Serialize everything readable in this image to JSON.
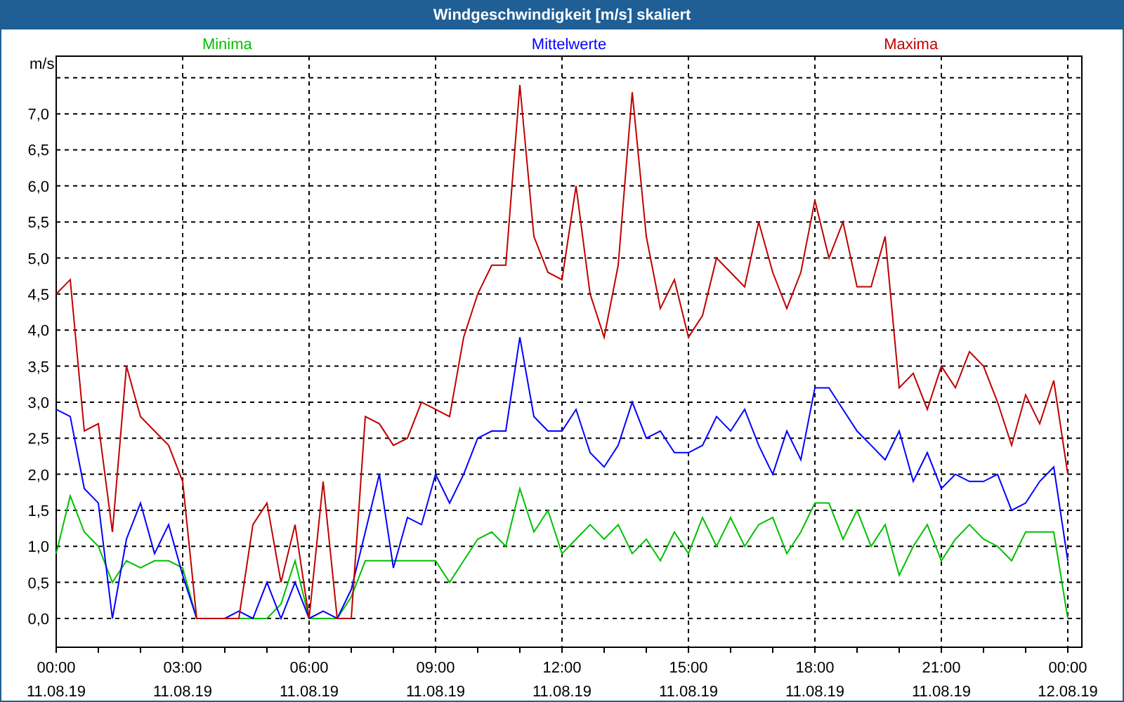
{
  "window": {
    "title": "Windgeschwindigkeit [m/s] skaliert"
  },
  "chart": {
    "chart_data": {
      "type": "line",
      "grid": true,
      "ylabel": "m/s",
      "categories": [
        "00:00",
        null,
        null,
        null,
        null,
        null,
        null,
        null,
        null,
        "03:00",
        null,
        null,
        null,
        null,
        null,
        null,
        null,
        null,
        "06:00",
        null,
        null,
        null,
        null,
        null,
        null,
        null,
        null,
        "09:00",
        null,
        null,
        null,
        null,
        null,
        null,
        null,
        null,
        "12:00",
        null,
        null,
        null,
        null,
        null,
        null,
        null,
        null,
        "15:00",
        null,
        null,
        null,
        null,
        null,
        null,
        null,
        null,
        "18:00",
        null,
        null,
        null,
        null,
        null,
        null,
        null,
        null,
        "21:00",
        null,
        null,
        null,
        null,
        null,
        null,
        null,
        null,
        "00:00"
      ],
      "series": [
        {
          "name": "Minima",
          "color": "#00c000",
          "values": [
            0.9,
            1.7,
            1.2,
            1.0,
            0.5,
            0.8,
            0.7,
            0.8,
            0.8,
            0.7,
            0,
            0,
            0,
            0,
            0,
            0,
            0.2,
            0.8,
            0,
            0,
            0,
            0.3,
            0.8,
            0.8,
            0.8,
            0.8,
            0.8,
            0.8,
            0.5,
            0.8,
            1.1,
            1.2,
            1.0,
            1.8,
            1.2,
            1.5,
            0.9,
            1.1,
            1.3,
            1.1,
            1.3,
            0.9,
            1.1,
            0.8,
            1.2,
            0.9,
            1.4,
            1.0,
            1.4,
            1.0,
            1.3,
            1.4,
            0.9,
            1.2,
            1.6,
            1.6,
            1.1,
            1.5,
            1.0,
            1.3,
            0.6,
            1.0,
            1.3,
            0.8,
            1.1,
            1.3,
            1.1,
            1.0,
            0.8,
            1.2,
            1.2,
            1.2,
            0.0
          ]
        },
        {
          "name": "Mittelwerte",
          "color": "#0000ff",
          "values": [
            2.9,
            2.8,
            1.8,
            1.6,
            0,
            1.1,
            1.6,
            0.9,
            1.3,
            0.6,
            0,
            0,
            0,
            0.1,
            0,
            0.5,
            0,
            0.5,
            0,
            0.1,
            0,
            0.4,
            1.2,
            2.0,
            0.7,
            1.4,
            1.3,
            2.0,
            1.6,
            2.0,
            2.5,
            2.6,
            2.6,
            3.9,
            2.8,
            2.6,
            2.6,
            2.9,
            2.3,
            2.1,
            2.4,
            3.0,
            2.5,
            2.6,
            2.3,
            2.3,
            2.4,
            2.8,
            2.6,
            2.9,
            2.4,
            2.0,
            2.6,
            2.2,
            3.2,
            3.2,
            2.9,
            2.6,
            2.4,
            2.2,
            2.6,
            1.9,
            2.3,
            1.8,
            2.0,
            1.9,
            1.9,
            2.0,
            1.5,
            1.6,
            1.9,
            2.1,
            0.8
          ]
        },
        {
          "name": "Maxima",
          "color": "#c00000",
          "values": [
            4.5,
            4.7,
            2.6,
            2.7,
            1.2,
            3.5,
            2.8,
            2.6,
            2.4,
            1.9,
            0,
            0,
            0,
            0,
            1.3,
            1.6,
            0.5,
            1.3,
            0,
            1.9,
            0,
            0,
            2.8,
            2.7,
            2.4,
            2.5,
            3.0,
            2.9,
            2.8,
            3.9,
            4.5,
            4.9,
            4.9,
            7.4,
            5.3,
            4.8,
            4.7,
            6.0,
            4.5,
            3.9,
            4.9,
            7.3,
            5.3,
            4.3,
            4.7,
            3.9,
            4.2,
            5.0,
            4.8,
            4.6,
            5.5,
            4.8,
            4.3,
            4.8,
            5.8,
            5.0,
            5.5,
            4.6,
            4.6,
            5.3,
            3.2,
            3.4,
            2.9,
            3.5,
            3.2,
            3.7,
            3.5,
            3.0,
            2.4,
            3.1,
            2.7,
            3.3,
            2.0
          ]
        }
      ],
      "ylim": [
        -0.4,
        7.8
      ],
      "yticks": [
        {
          "value": 0,
          "label": "0,0"
        },
        {
          "value": 0.5,
          "label": "0,5"
        },
        {
          "value": 1,
          "label": "1,0"
        },
        {
          "value": 1.5,
          "label": "1,5"
        },
        {
          "value": 2,
          "label": "2,0"
        },
        {
          "value": 2.5,
          "label": "2,5"
        },
        {
          "value": 3,
          "label": "3,0"
        },
        {
          "value": 3.5,
          "label": "3,5"
        },
        {
          "value": 4,
          "label": "4,0"
        },
        {
          "value": 4.5,
          "label": "4,5"
        },
        {
          "value": 5,
          "label": "5,0"
        },
        {
          "value": 5.5,
          "label": "5,5"
        },
        {
          "value": 6,
          "label": "6,0"
        },
        {
          "value": 6.5,
          "label": "6,5"
        },
        {
          "value": 7,
          "label": "7,0"
        }
      ]
    },
    "tick_dates": [
      "11.08.19",
      "11.08.19",
      "11.08.19",
      "11.08.19",
      "11.08.19",
      "11.08.19",
      "11.08.19",
      "11.08.19",
      "12.08.19"
    ]
  }
}
